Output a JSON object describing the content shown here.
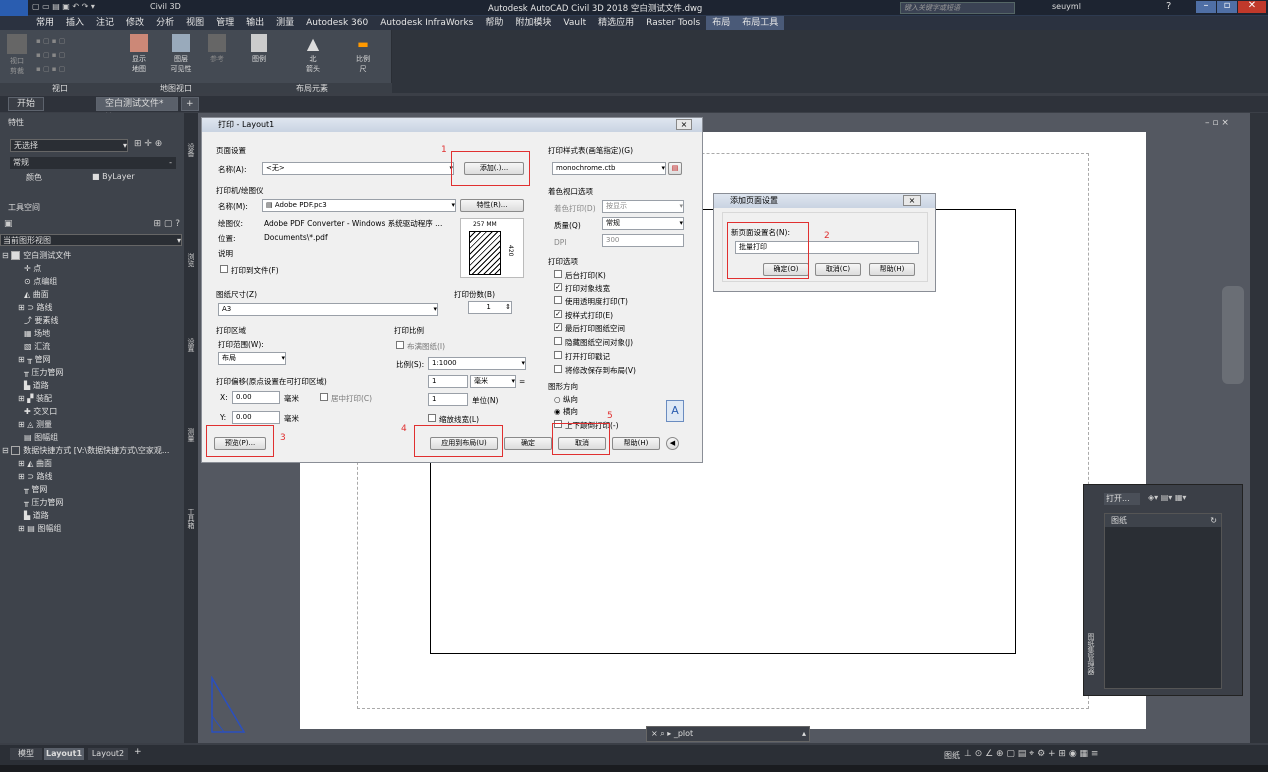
{
  "titlebar": {
    "logo": "CIVIL",
    "app_switcher": "Civil 3D",
    "title": "Autodesk AutoCAD Civil 3D 2018    空白测试文件.dwg",
    "search_placeholder": "键入关键字或短语",
    "user": "seuyml"
  },
  "menus": [
    "常用",
    "插入",
    "注记",
    "修改",
    "分析",
    "视图",
    "管理",
    "输出",
    "测量",
    "Autodesk 360",
    "Autodesk InfraWorks",
    "帮助",
    "附加模块",
    "Vault",
    "精选应用",
    "Raster Tools",
    "布局",
    "布局工具"
  ],
  "ribbon": {
    "btns": [
      {
        "l": "视口\n剪裁"
      },
      {
        "l": "显示\n地图"
      },
      {
        "l": "图层\n可见性"
      },
      {
        "l": "参考"
      },
      {
        "l": "图例"
      },
      {
        "l": "北\n箭头"
      },
      {
        "l": "比例\n尺"
      }
    ],
    "groups": [
      "视口",
      "地图视口",
      "布局元素"
    ]
  },
  "tabs": {
    "start": "开始",
    "doc": "空白测试文件*"
  },
  "props": {
    "header": "特性",
    "select": "无选择",
    "section": "常规",
    "color_label": "颜色",
    "color_value": "ByLayer"
  },
  "toolspace": {
    "header": "工具空间",
    "view": "当前图形视图",
    "root": "空白测试文件",
    "items": [
      "点",
      "点编组",
      "曲面",
      "路线",
      "要素线",
      "场地",
      "汇流",
      "管网",
      "压力管网",
      "道路",
      "装配",
      "交叉口",
      "测量",
      "图幅组"
    ],
    "ds": "数据快捷方式 [V:\\数据快捷方式\\空家观...",
    "ds_items": [
      "曲面",
      "路线",
      "管网",
      "压力管网",
      "道路",
      "图幅组"
    ]
  },
  "vtabs": [
    "设备",
    "浏览",
    "设置",
    "测量",
    "工具箱"
  ],
  "plot": {
    "title": "打印 - Layout1",
    "page_setup": "页面设置",
    "name_label": "名称(A):",
    "name_value": "<无>",
    "add": "添加(.)...",
    "printer": "打印机/绘图仪",
    "pname_label": "名称(M):",
    "pname_value": "Adobe PDF.pc3",
    "props": "特性(R)...",
    "plotter_label": "绘图仪:",
    "plotter_value": "Adobe PDF Converter - Windows 系统驱动程序 ...",
    "where_label": "位置:",
    "where_value": "Documents\\*.pdf",
    "desc_label": "说明",
    "tofile": "打印到文件(F)",
    "dim_w": "257 MM",
    "dim_h": "420",
    "paper_size": "图纸尺寸(Z)",
    "paper_value": "A3",
    "copies": "打印份数(B)",
    "copies_value": "1",
    "area": "打印区域",
    "what_label": "打印范围(W):",
    "what_value": "布局",
    "offset": "打印偏移(原点设置在可打印区域)",
    "x_label": "X:",
    "x_value": "0.00",
    "y_label": "Y:",
    "y_value": "0.00",
    "mm": "毫米",
    "center": "居中打印(C)",
    "scale": "打印比例",
    "fit": "布满图纸(I)",
    "scale_label": "比例(S):",
    "scale_value": "1:1000",
    "s1": "1",
    "unit": "毫米",
    "s2": "1",
    "unit2": "单位(N)",
    "lw": "缩放线宽(L)",
    "style_table": "打印样式表(画笔指定)(G)",
    "style_value": "monochrome.ctb",
    "shaded": "着色视口选项",
    "shade_label": "着色打印(D)",
    "shade_value": "按显示",
    "quality_label": "质量(Q)",
    "quality_value": "常规",
    "dpi_label": "DPI",
    "dpi_value": "300",
    "options": "打印选项",
    "opts": [
      "后台打印(K)",
      "打印对象线宽",
      "使用透明度打印(T)",
      "按样式打印(E)",
      "最后打印图纸空间",
      "隐藏图纸空间对象(J)",
      "打开打印戳记",
      "将修改保存到布局(V)"
    ],
    "orient": "图形方向",
    "portrait": "纵向",
    "landscape": "横向",
    "upside": "上下颠倒打印(-)",
    "preview": "预览(P)...",
    "apply": "应用到布局(U)",
    "ok": "确定",
    "cancel": "取消",
    "help": "帮助(H)"
  },
  "addps": {
    "title": "添加页面设置",
    "label": "新页面设置名(N):",
    "value": "批量打印",
    "ok": "确定(O)",
    "cancel": "取消(C)",
    "help": "帮助(H)"
  },
  "markers": [
    "1",
    "2",
    "3",
    "4",
    "5"
  ],
  "cmd": {
    "text": "_plot"
  },
  "sheet": {
    "open": "打开...",
    "label": "图纸",
    "side": "图纸集管理器"
  },
  "layouts": [
    "模型",
    "Layout1",
    "Layout2"
  ],
  "status": {
    "paper": "图纸"
  }
}
